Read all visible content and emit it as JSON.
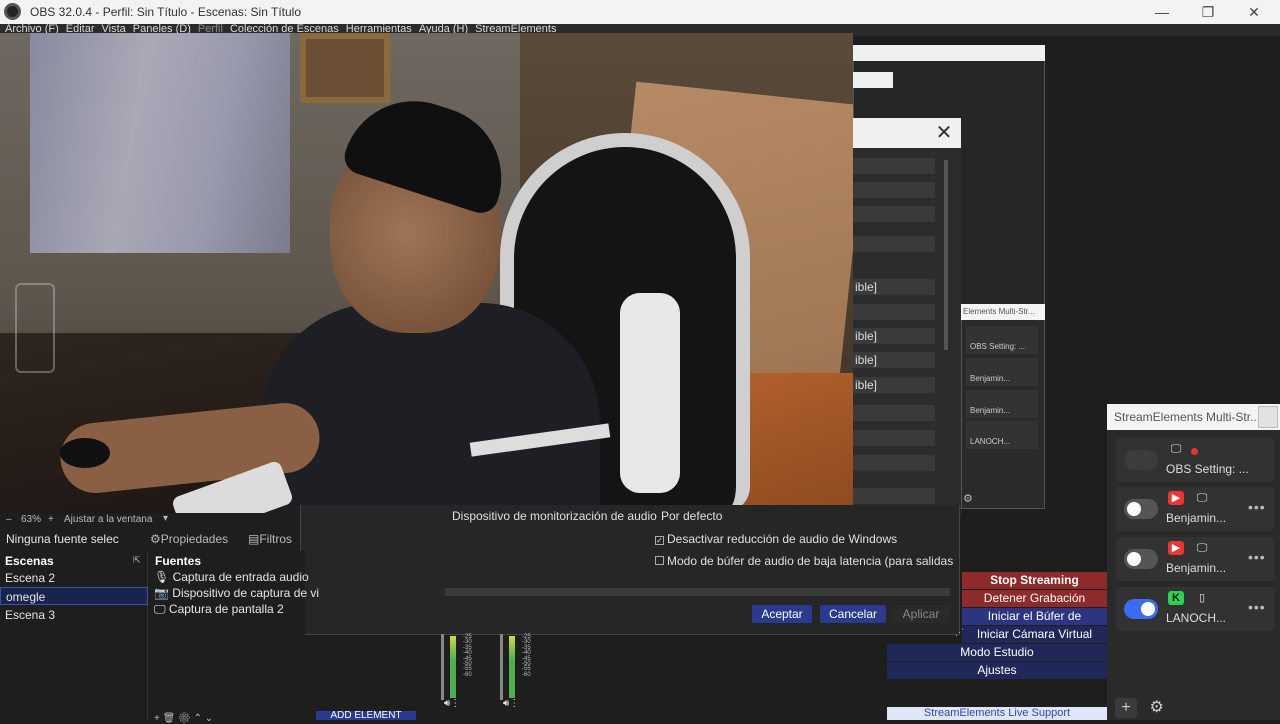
{
  "window": {
    "title": "OBS 32.0.4 - Perfil: Sin Título - Escenas: Sin Título",
    "minimize": "—",
    "maximize": "❐",
    "close": "✕"
  },
  "menu": [
    "Archivo (F)",
    "Editar",
    "Vista",
    "Paneles (D)",
    "Perfil",
    "Colección de Escenas",
    "Herramientas",
    "Ayuda (H)",
    "StreamElements"
  ],
  "settings_dialog": {
    "close": "✕",
    "fields": [
      "ible]",
      "ible]",
      "ible]",
      "ible]"
    ],
    "monitor_label": "Dispositivo de monitorización de audio",
    "monitor_value": "Por defecto",
    "opt1": "Desactivar reducción de audio de Windows",
    "opt2": "Modo de búfer de audio de baja latencia (para salidas",
    "ok": "Aceptar",
    "cancel": "Cancelar",
    "apply": "Aplicar"
  },
  "zoom": {
    "minus": "–",
    "value": "63%",
    "plus": "+",
    "fit": "Ajustar a la ventana",
    "caret": "▾"
  },
  "source_toolbar": {
    "selection": "Ninguna fuente selec",
    "properties": "Propiedades",
    "filters": "Filtros"
  },
  "scenes": {
    "title": "Escenas",
    "items": [
      "Escena 2",
      "omegle",
      "Escena 3"
    ]
  },
  "sources": {
    "title": "Fuentes",
    "items": [
      "Captura de entrada audio",
      "Dispositivo de captura de vi",
      "Captura de pantalla 2"
    ]
  },
  "meters": {
    "scale": [
      "-25",
      "-30",
      "-35",
      "-40",
      "-45",
      "-50",
      "-55",
      "-60"
    ]
  },
  "bottom_misc": {
    "add_element": "ADD ELEMENT"
  },
  "controls": {
    "stop_streaming": "Stop Streaming",
    "stop_recording": "Detener Grabación",
    "replay_buffer": "Iniciar el Búfer de Repetición",
    "virtual_cam": "Iniciar Cámara Virtual",
    "studio_mode": "Modo Estudio",
    "settings": "Ajustes",
    "support": "StreamElements Live Support"
  },
  "se_panel": {
    "title": "StreamElements Multi-Str...",
    "rows": [
      {
        "label": "OBS Setting: ...",
        "icon": "monitor-icon",
        "status": "red-dot",
        "toggle": "disabled"
      },
      {
        "label": "Benjamin...",
        "icon": "youtube-icon",
        "toggle": "off"
      },
      {
        "label": "Benjamin...",
        "icon": "youtube-icon",
        "toggle": "off"
      },
      {
        "label": "LANOCH...",
        "icon": "kick-icon",
        "toggle": "on"
      }
    ],
    "more": "•••",
    "add": "+",
    "gear": "⚙"
  },
  "se_mini": {
    "title": "Elements Multi-Str...",
    "rows": [
      "OBS Setting: ...",
      "Benjamin...",
      "Benjamin...",
      "LANOCH..."
    ]
  },
  "colors": {
    "accent": "#2a3a8f",
    "stop": "#8f2a2a",
    "toggle_on": "#3d6cf0",
    "youtube": "#ee3333",
    "kick": "#2bd44a"
  }
}
